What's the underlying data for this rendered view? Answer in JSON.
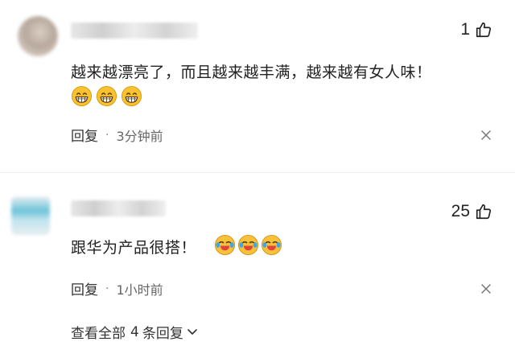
{
  "comments": [
    {
      "username": "",
      "like_count": "1",
      "text": "越来越漂亮了，而且越来越丰满，越来越有女人味！",
      "emojis": [
        "grin-emoji",
        "grin-emoji",
        "grin-emoji"
      ],
      "reply_label": "回复",
      "separator": "·",
      "time": "3分钟前"
    },
    {
      "username": "",
      "like_count": "25",
      "text": "跟华为产品很搭！",
      "emojis": [
        "laugh-cry-emoji",
        "laugh-cry-emoji",
        "laugh-cry-emoji"
      ],
      "reply_label": "回复",
      "separator": "·",
      "time": "1小时前"
    }
  ],
  "view_replies": {
    "prefix": "查看全部",
    "count": "4",
    "suffix": "条回复"
  },
  "icons": {
    "like": "thumbs-up-icon",
    "dismiss": "close-icon",
    "expand": "chevron-down-icon"
  },
  "colors": {
    "text": "#222222",
    "meta": "#666666",
    "emoji_face": "#f9c22e",
    "divider": "#ececec"
  }
}
